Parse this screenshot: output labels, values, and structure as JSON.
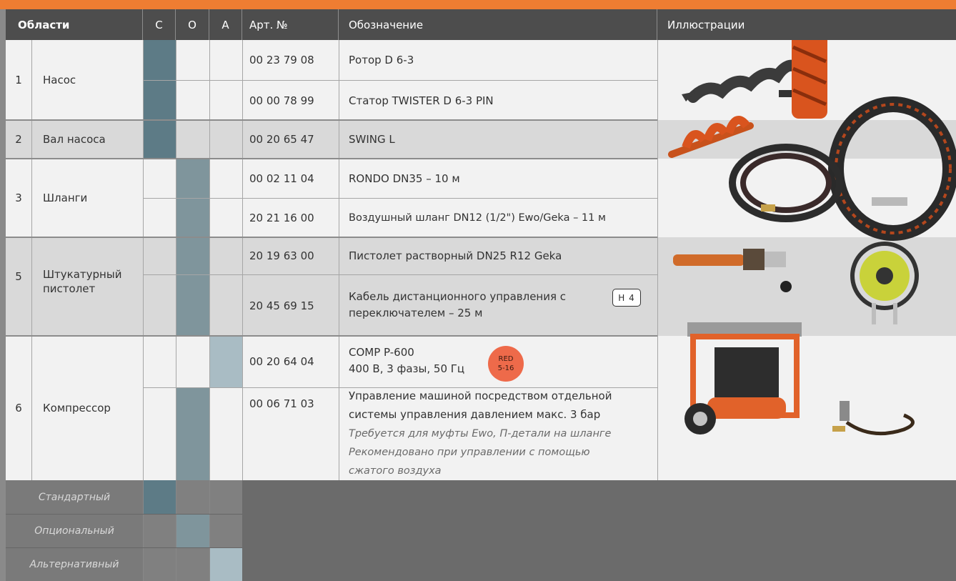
{
  "header": {
    "areas": "Области",
    "col_c": "C",
    "col_o": "O",
    "col_a": "A",
    "article": "Арт. №",
    "designation": "Обозначение",
    "illustrations": "Иллюстрации"
  },
  "groups": [
    {
      "num": "1",
      "name": "Насос"
    },
    {
      "num": "2",
      "name": "Вал насоса"
    },
    {
      "num": "3",
      "name": "Шланги"
    },
    {
      "num": "5",
      "name": "Штукатурный пистолет"
    },
    {
      "num": "6",
      "name": "Компрессор"
    }
  ],
  "items": [
    {
      "art": "00 23 79 08",
      "name": "Ротор D 6-3",
      "type": "standard"
    },
    {
      "art": "00 00 78 99",
      "name": "Статор TWISTER D 6-3 PIN",
      "type": "standard"
    },
    {
      "art": "00 20 65 47",
      "name": "SWING L",
      "type": "standard"
    },
    {
      "art": "00 02 11 04",
      "name": "RONDO DN35 – 10 м",
      "type": "optional"
    },
    {
      "art": "20 21 16 00",
      "name": "Воздушный шланг DN12 (1/2\") Ewo/Geka – 11 м",
      "type": "optional"
    },
    {
      "art": "20 19 63 00",
      "name": "Пистолет растворный  DN25 R12 Geka",
      "type": "optional"
    },
    {
      "art": "20 45 69 15",
      "name_line1": "Кабель дистанционного управления с",
      "name_line2": "переключателем – 25 м",
      "badge": "H 4",
      "type": "optional"
    },
    {
      "art": "00 20 64 04",
      "name_line1": "COMP P-600",
      "name_line2": "400 В, 3 фазы, 50 Гц",
      "badge_line1": "RED",
      "badge_line2": "5-16",
      "type": "alternative"
    },
    {
      "art": "00 06 71 03",
      "name_line1": "Управление машиной посредством отдельной",
      "name_line2": "системы управления давлением макс. 3 бар",
      "note_line1": "Требуется для муфты Ewo, П-детали на шланге",
      "note_line2": "Рекомендовано при управлении с помощью",
      "note_line3": "сжатого воздуха",
      "type": "optional"
    }
  ],
  "legend": {
    "standard": "Стандартный",
    "optional": "Опциональный",
    "alternative": "Альтернативный"
  },
  "illustrations": [
    "rotor-image",
    "stator-image",
    "swing-shaft-image",
    "hose-image",
    "air-hose-image",
    "plaster-gun-image",
    "cable-reel-image",
    "compressor-image",
    "pressure-control-image"
  ],
  "colors": {
    "accent": "#ee7d32",
    "standard": "#5d7b86",
    "optional": "#7f959c",
    "alternative": "#a9bcc4",
    "red_badge": "#ee6a4a"
  }
}
